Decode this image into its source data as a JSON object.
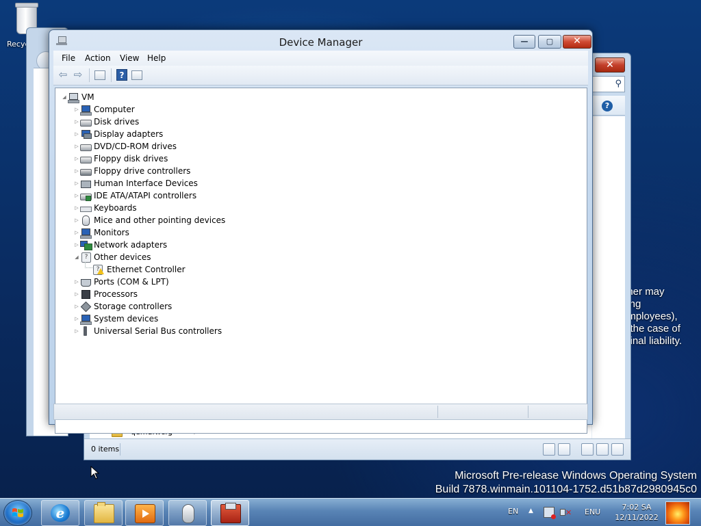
{
  "desktop": {
    "recycle_bin_label": "Recyc",
    "background_text_lines": [
      "nner may",
      "ding",
      "employees),",
      "n the case of",
      "minal liability."
    ],
    "watermark_line1": "Microsoft Pre-release Windows Operating System",
    "watermark_line2": "Build 7878.winmain.101104-1752.d51b87d2980945c0"
  },
  "explorer_window": {
    "close_label": "✕",
    "help_label": "?",
    "nav_folder": "qemufwcfg",
    "status_count": "0 items"
  },
  "device_manager": {
    "title": "Device Manager",
    "min_label": "—",
    "max_label": "▢",
    "close_label": "✕",
    "menu": [
      "File",
      "Action",
      "View",
      "Help"
    ],
    "toolbar": {
      "back_icon": "back-arrow-icon",
      "forward_icon": "forward-arrow-icon",
      "properties_icon": "properties-icon",
      "help_icon": "help-icon",
      "help_label": "?",
      "view_icon": "view-icon"
    },
    "tree": {
      "root": "VM",
      "categories": [
        {
          "label": "Computer",
          "icon": "computer-icon",
          "expanded": false
        },
        {
          "label": "Disk drives",
          "icon": "disk-drive-icon",
          "expanded": false
        },
        {
          "label": "Display adapters",
          "icon": "display-adapter-icon",
          "expanded": false
        },
        {
          "label": "DVD/CD-ROM drives",
          "icon": "dvd-drive-icon",
          "expanded": false
        },
        {
          "label": "Floppy disk drives",
          "icon": "floppy-disk-icon",
          "expanded": false
        },
        {
          "label": "Floppy drive controllers",
          "icon": "floppy-controller-icon",
          "expanded": false
        },
        {
          "label": "Human Interface Devices",
          "icon": "hid-icon",
          "expanded": false
        },
        {
          "label": "IDE ATA/ATAPI controllers",
          "icon": "ide-controller-icon",
          "expanded": false
        },
        {
          "label": "Keyboards",
          "icon": "keyboard-icon",
          "expanded": false
        },
        {
          "label": "Mice and other pointing devices",
          "icon": "mouse-icon",
          "expanded": false
        },
        {
          "label": "Monitors",
          "icon": "monitor-icon",
          "expanded": false
        },
        {
          "label": "Network adapters",
          "icon": "network-adapter-icon",
          "expanded": false
        },
        {
          "label": "Other devices",
          "icon": "unknown-device-icon",
          "expanded": true,
          "children": [
            "Ethernet Controller"
          ]
        },
        {
          "label": "Ports (COM & LPT)",
          "icon": "port-icon",
          "expanded": false
        },
        {
          "label": "Processors",
          "icon": "processor-icon",
          "expanded": false
        },
        {
          "label": "Storage controllers",
          "icon": "storage-controller-icon",
          "expanded": false
        },
        {
          "label": "System devices",
          "icon": "system-device-icon",
          "expanded": false
        },
        {
          "label": "Universal Serial Bus controllers",
          "icon": "usb-icon",
          "expanded": false
        }
      ]
    }
  },
  "taskbar": {
    "apps": [
      {
        "name": "internet-explorer",
        "icon": "ie-icon",
        "glyph": "e"
      },
      {
        "name": "windows-explorer",
        "icon": "folder-icon"
      },
      {
        "name": "media-player",
        "icon": "media-player-icon"
      },
      {
        "name": "mouse-properties",
        "icon": "mouse-icon"
      },
      {
        "name": "device-manager",
        "icon": "device-manager-icon",
        "active": true
      }
    ],
    "language": "EN",
    "input_method": "ENU",
    "time": "7:02 SA",
    "date": "12/11/2022"
  }
}
